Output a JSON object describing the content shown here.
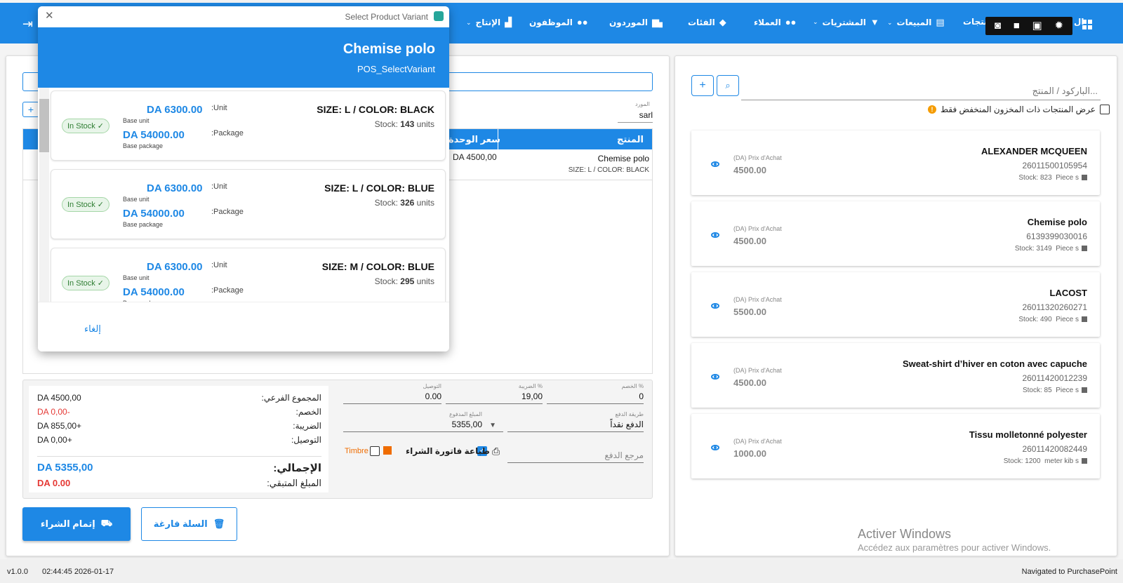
{
  "nav": {
    "items": [
      {
        "label": "الإنتاج",
        "icon": "factory-icon",
        "dropdown": true
      },
      {
        "label": "الموظفون",
        "icon": "users-icon",
        "dropdown": false
      },
      {
        "label": "الموردون",
        "icon": "truck-icon",
        "dropdown": false
      },
      {
        "label": "الفئات",
        "icon": "tags-icon",
        "dropdown": false
      },
      {
        "label": "العملاء",
        "icon": "users-icon",
        "dropdown": false
      },
      {
        "label": "المشتريات",
        "icon": "cart-icon",
        "dropdown": true
      },
      {
        "label": "المبيعات",
        "icon": "register-icon",
        "dropdown": true
      },
      {
        "label": "منتجات",
        "icon": "box-icon",
        "dropdown": false
      }
    ],
    "partial_label": "ال",
    "dropdown_glyph": "⌄",
    "colors": {
      "accent": "#1e88e5"
    }
  },
  "products_panel": {
    "search_placeholder": "الباركود / المنتج...",
    "low_stock_label": "عرض المنتجات ذات المخزون المنخفض فقط",
    "price_label": "(DA) Prix d'Achat",
    "stock_label": "Stock:",
    "products": [
      {
        "name": "ALEXANDER MCQUEEN",
        "code": "26011500105954",
        "stock": "823",
        "unit": "Piece s",
        "price": "4500.00"
      },
      {
        "name": "Chemise polo",
        "code": "6139399030016",
        "stock": "3149",
        "unit": "Piece s",
        "price": "4500.00"
      },
      {
        "name": "LACOST",
        "code": "26011320260271",
        "stock": "490",
        "unit": "Piece s",
        "price": "5500.00"
      },
      {
        "name": "Sweat-shirt d’hiver en coton avec capuche",
        "code": "26011420012239",
        "stock": "85",
        "unit": "Piece s",
        "price": "4500.00"
      },
      {
        "name": "Tissu molletonné polyester",
        "code": "26011420082449",
        "stock": "1200",
        "unit": "meter kib s",
        "price": "1000.00"
      }
    ]
  },
  "cart": {
    "supplier_label": "المورد",
    "supplier_value": "sarl",
    "columns": {
      "product": "المنتج",
      "unit_price": "سعر الوحدة"
    },
    "rows": [
      {
        "product": "Chemise polo",
        "variant": "SIZE: L / COLOR: BLACK",
        "unit_price": "DA 4500,00"
      }
    ]
  },
  "totals": {
    "subtotal_label": "المجموع الفرعي:",
    "subtotal": "DA 4500,00",
    "discount_label": "الخصم:",
    "discount": "DA 0,00-",
    "tax_label": "الضريبة:",
    "tax": "DA 855,00+",
    "delivery_label": "التوصيل:",
    "delivery": "DA 0,00+",
    "total_label": "الإجمالي:",
    "total": "DA 5355,00",
    "remaining_label": "المبلغ المتبقي:",
    "remaining": "DA 0.00",
    "fields": {
      "discount_pct_label": "الخصم %",
      "discount_pct": "0",
      "tax_pct_label": "الضريبة %",
      "tax_pct": "19,00",
      "delivery_label": "التوصيل",
      "delivery": "0.00",
      "payment_method_label": "طريقة الدفع",
      "payment_method": "الدفع نقداً",
      "paid_label": "المبلغ المدفوع",
      "paid": "5355,00",
      "payment_ref_placeholder": "مرجع الدفع",
      "print_invoice_label": "طباعة فاتورة الشراء",
      "timbre_label": "Timbre"
    }
  },
  "buttons": {
    "complete_purchase": "إتمام الشراء",
    "empty_cart": "السلة فارغة"
  },
  "status_bar": {
    "version": "v1.0.0",
    "datetime": "02:44:45 2026-01-17",
    "message": "Navigated to PurchasePoint"
  },
  "watermark": {
    "title": "Activer Windows",
    "subtitle": "Accédez aux paramètres pour activer Windows."
  },
  "modal": {
    "window_title": "Select Product Variant",
    "product_name": "Chemise polo",
    "subtitle": "POS_SelectVariant",
    "unit_label": ":Unit",
    "package_label": ":Package",
    "base_unit": "Base unit",
    "base_package": "Base package",
    "stock_label": "Stock:",
    "stock_units": "units",
    "badge": "In Stock ✓",
    "cancel": "إلغاء",
    "variants": [
      {
        "name": "SIZE: L / COLOR: BLACK",
        "stock": "143",
        "unit_price": "DA 6300.00",
        "package_price": "DA 54000.00"
      },
      {
        "name": "SIZE: L / COLOR: BLUE",
        "stock": "326",
        "unit_price": "DA 6300.00",
        "package_price": "DA 54000.00"
      },
      {
        "name": "SIZE: M / COLOR: BLUE",
        "stock": "295",
        "unit_price": "DA 6300.00",
        "package_price": "DA 54000.00"
      }
    ]
  }
}
